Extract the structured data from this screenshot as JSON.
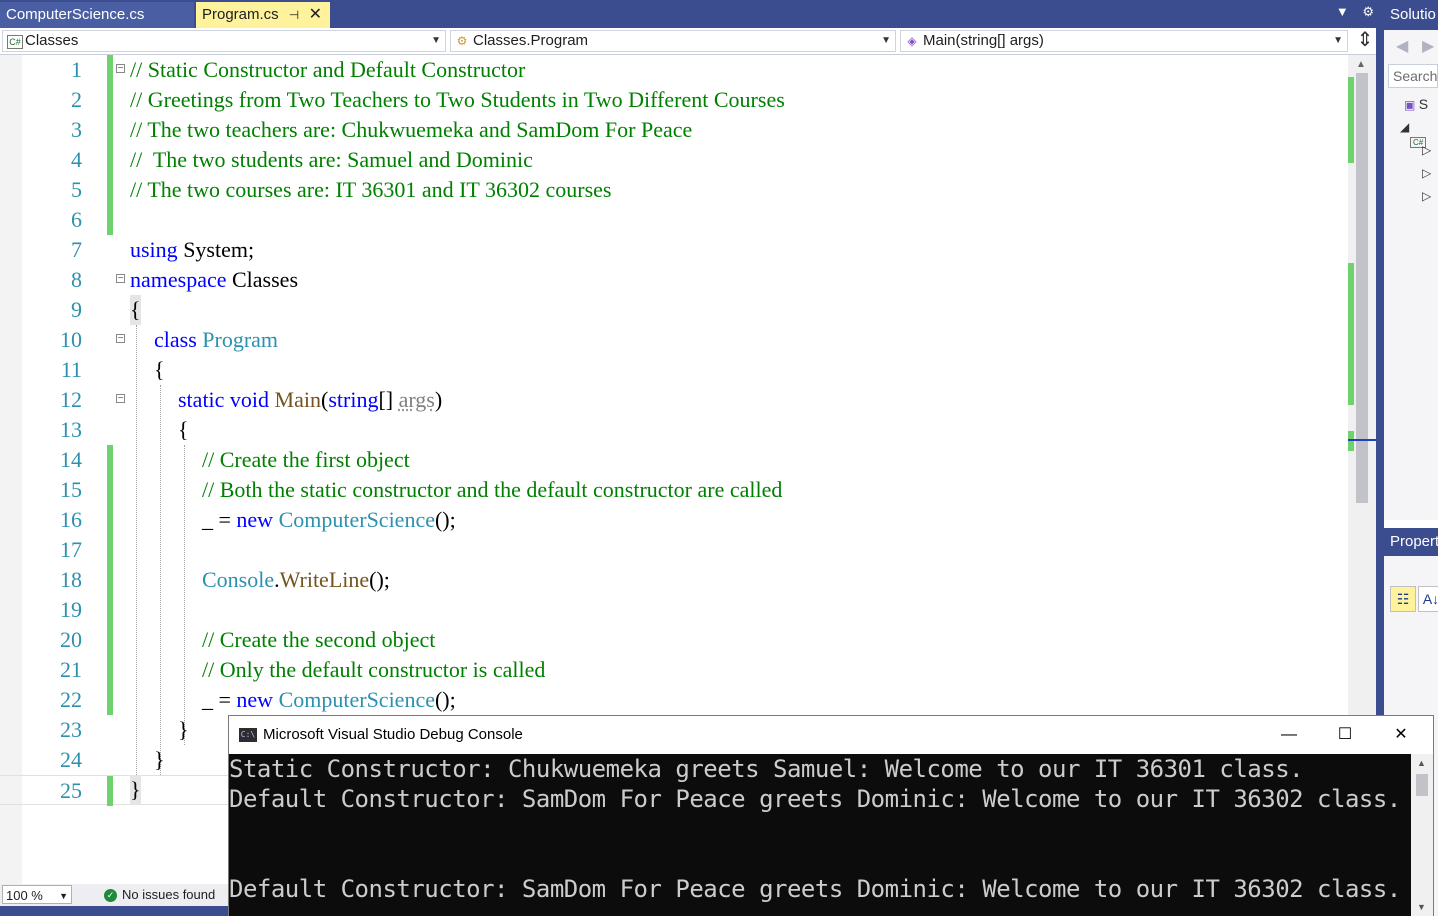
{
  "tabs": [
    {
      "label": "ComputerScience.cs",
      "active": false
    },
    {
      "label": "Program.cs",
      "active": true
    }
  ],
  "navbar": {
    "project": "Classes",
    "type": "Classes.Program",
    "member": "Main(string[] args)"
  },
  "editor": {
    "line_numbers": [
      "1",
      "2",
      "3",
      "4",
      "5",
      "6",
      "7",
      "8",
      "9",
      "10",
      "11",
      "12",
      "13",
      "14",
      "15",
      "16",
      "17",
      "18",
      "19",
      "20",
      "21",
      "22",
      "23",
      "24",
      "25"
    ],
    "lines": {
      "l1": "// Static Constructor and Default Constructor",
      "l2": "// Greetings from Two Teachers to Two Students in Two Different Courses",
      "l3": "// The two teachers are: Chukwuemeka and SamDom For Peace",
      "l4": "//  The two students are: Samuel and Dominic",
      "l5": "// The two courses are: IT 36301 and IT 36302 courses",
      "l7_kw": "using",
      "l7_rest": " System;",
      "l8_kw": "namespace",
      "l8_rest": " Classes",
      "l9": "{",
      "l10_kw": "class",
      "l10_type": " Program",
      "l11": "{",
      "l12_kw": "static void",
      "l12_method": " Main",
      "l12_paren": "(",
      "l12_kw2": "string",
      "l12_brk": "[] ",
      "l12_param": "args",
      "l12_close": ")",
      "l13": "{",
      "l14": "// Create the first object",
      "l15": "// Both the static constructor and the default constructor are called",
      "l16_pre": "_ = ",
      "l16_kw": "new",
      "l16_type": " ComputerScience",
      "l16_post": "();",
      "l18_type": "Console",
      "l18_dot": ".",
      "l18_method": "WriteLine",
      "l18_post": "();",
      "l20": "// Create the second object",
      "l21": "// Only the default constructor is called",
      "l22_pre": "_ = ",
      "l22_kw": "new",
      "l22_type": " ComputerScience",
      "l22_post": "();",
      "l23": "}",
      "l24": "}",
      "l25": "}"
    }
  },
  "status": {
    "zoom": "100 %",
    "issues": "No issues found"
  },
  "solution_panel": {
    "title": "Solutio",
    "search_placeholder": "Search",
    "tree_item": "S"
  },
  "properties_panel": {
    "title": "Propert"
  },
  "console": {
    "title": "Microsoft Visual Studio Debug Console",
    "icon_text": "C:\\",
    "lines": [
      "Static Constructor: Chukwuemeka greets Samuel: Welcome to our IT 36301 class.",
      "Default Constructor: SamDom For Peace greets Dominic: Welcome to our IT 36302 class.",
      "",
      "Default Constructor: SamDom For Peace greets Dominic: Welcome to our IT 36302 class."
    ]
  },
  "colors": {
    "keyword": "#0000ff",
    "type": "#2b91af",
    "comment": "#008000",
    "method": "#74531f",
    "line_number": "#2b91af",
    "change_marker": "#6ed36e",
    "chrome": "#3b4d8e",
    "active_tab": "#fff29d"
  }
}
